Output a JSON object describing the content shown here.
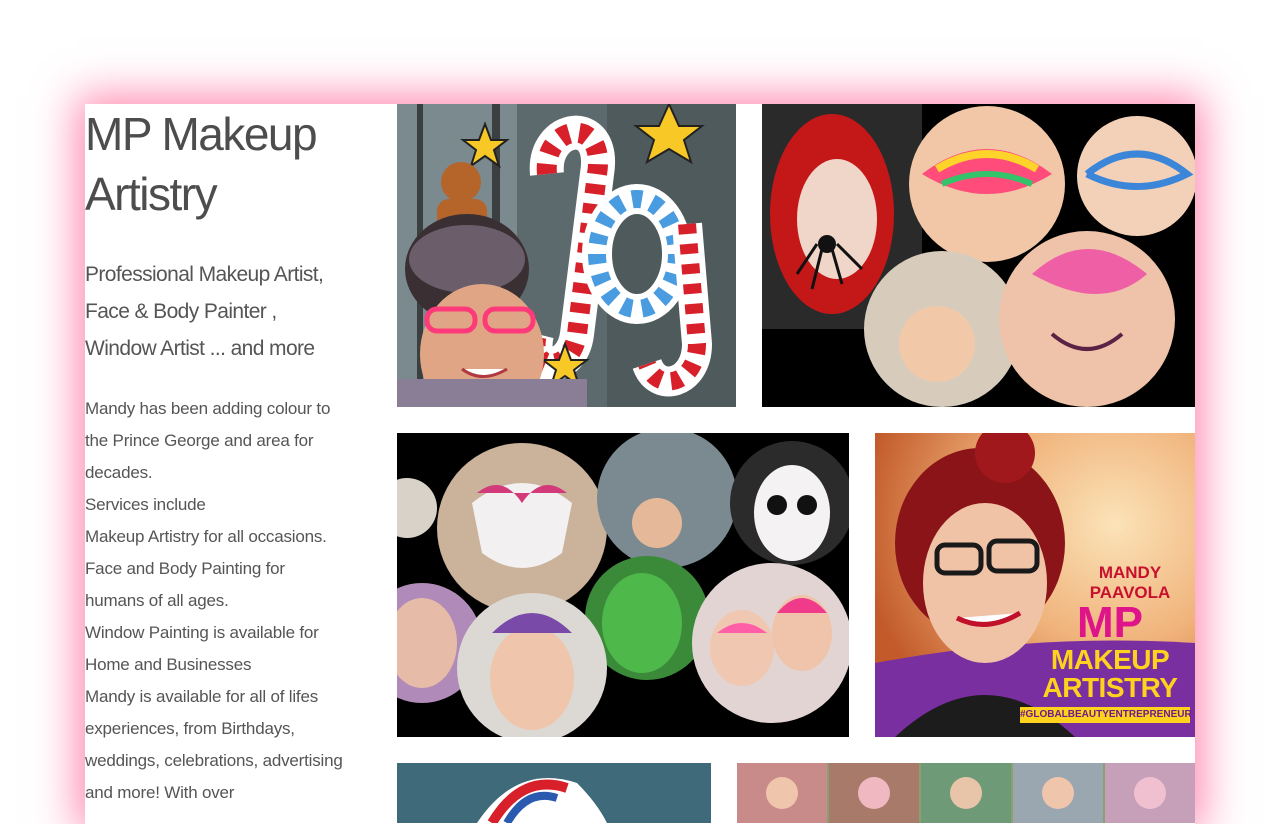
{
  "site": {
    "title": "MP Makeup Artistry",
    "tagline": "Professional Makeup Artist, Face & Body Painter , Window Artist ... and more"
  },
  "description": [
    "Mandy has been adding colour to the Prince George and area for decades.",
    "Services include",
    "Makeup Artistry for all occasions.",
    "Face and Body Painting for humans of all ages.",
    "Window Painting is available for Home and Businesses",
    "Mandy is available for all of lifes experiences, from Birthdays, weddings, celebrations, advertising and more! With over"
  ],
  "gallery": {
    "photos": [
      {
        "name": "joy-window-painting-selfie",
        "window_text": "Joy"
      },
      {
        "name": "face-paint-collage-spider"
      },
      {
        "name": "face-paint-collage-circles"
      },
      {
        "name": "mandy-paavola-promo",
        "promo_name": "MANDY PAAVOLA",
        "promo_logo": "MP",
        "promo_line1": "MAKEUP",
        "promo_line2": "ARTISTRY",
        "promo_hashtag": "#GLOBALBEAUTYENTREPRENEUR"
      },
      {
        "name": "window-painting-partial"
      },
      {
        "name": "group-face-paint-strip"
      }
    ]
  },
  "colors": {
    "accent_glow": "#ff286e",
    "text": "#4d4d4d"
  }
}
